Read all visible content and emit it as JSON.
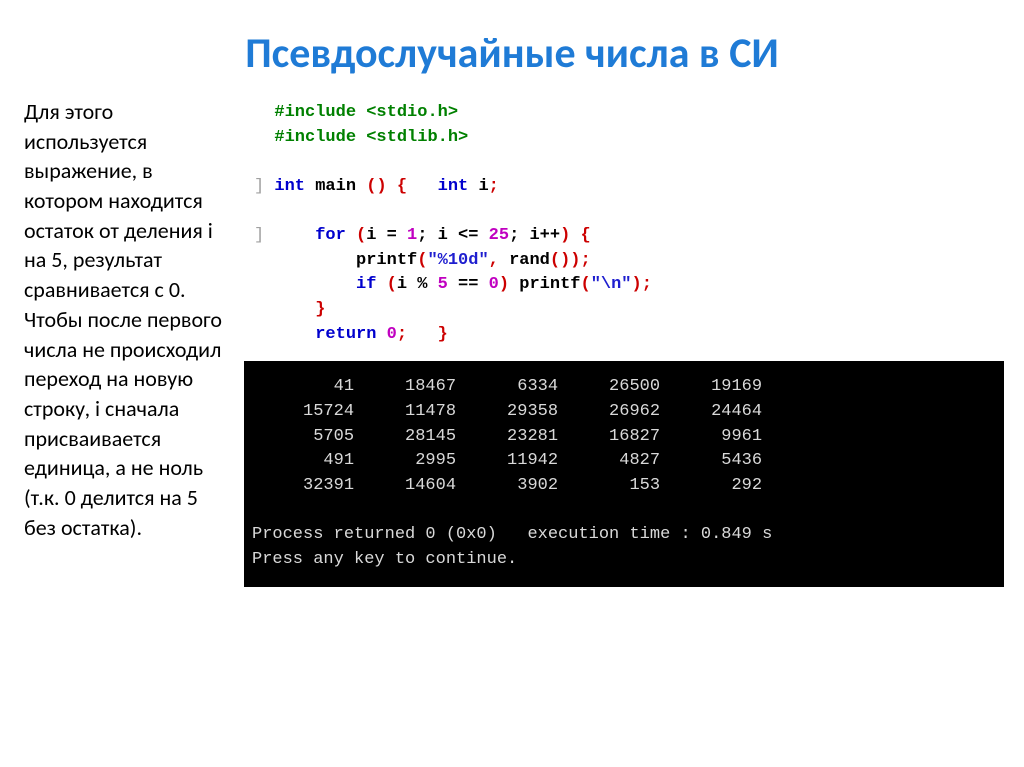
{
  "title": "Псевдослучайные числа в СИ",
  "body_text": "Для этого используется выражение, в котором находится остаток от деления i на 5, результат сравнивается с 0. Чтобы после первого числа не происходил переход на новую строку, i сначала присваивается единица, а не ноль (т.к. 0 делится на 5 без остатка).",
  "code": {
    "include1_kw": "#include",
    "include1_hdr": "<stdio.h>",
    "include2_kw": "#include",
    "include2_hdr": "<stdlib.h>",
    "int": "int",
    "main": "main",
    "int2": "int",
    "var_i": "i",
    "for": "for",
    "for_init": "i = ",
    "one": "1",
    "sep1": "; i <= ",
    "twentyfive": "25",
    "sep2": "; i++",
    "printf1": "printf",
    "fmt1": "\"%10d\"",
    "rand": "rand",
    "if": "if",
    "mod": "i % ",
    "five": "5",
    "eqeq": " == ",
    "zero": "0",
    "printf2": "printf",
    "fmt2": "\"\\n\"",
    "return": "return",
    "retval": "0"
  },
  "console": {
    "rows": [
      [
        "41",
        "18467",
        "6334",
        "26500",
        "19169"
      ],
      [
        "15724",
        "11478",
        "29358",
        "26962",
        "24464"
      ],
      [
        "5705",
        "28145",
        "23281",
        "16827",
        "9961"
      ],
      [
        "491",
        "2995",
        "11942",
        "4827",
        "5436"
      ],
      [
        "32391",
        "14604",
        "3902",
        "153",
        "292"
      ]
    ],
    "status1": "Process returned 0 (0x0)   execution time : 0.849 s",
    "status2": "Press any key to continue."
  }
}
